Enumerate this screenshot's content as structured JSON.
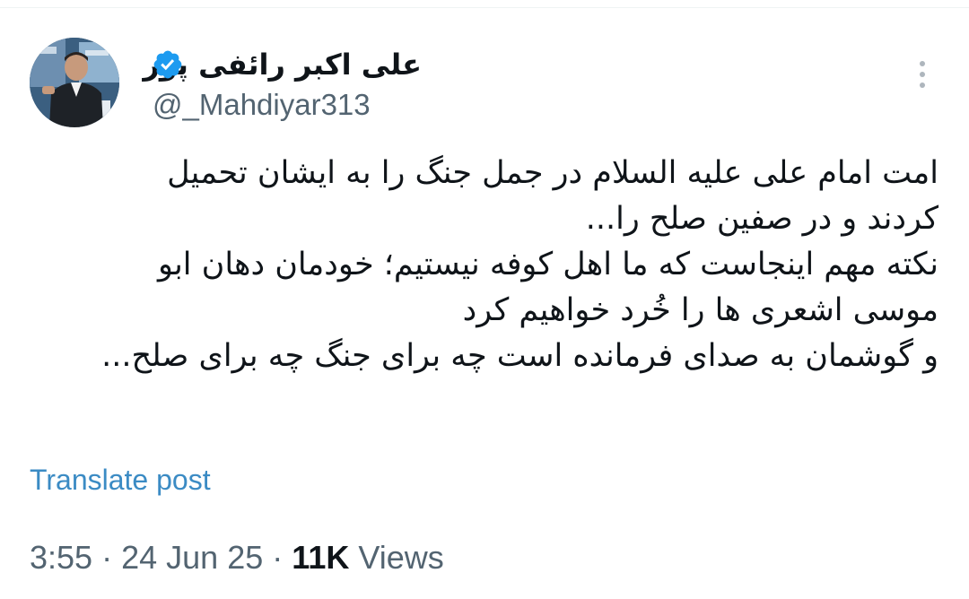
{
  "author": {
    "display_name": "علی اکبر رائفی پور",
    "handle": "@_Mahdiyar313",
    "verified": true,
    "avatar_icon": "profile-photo"
  },
  "post": {
    "lines": [
      "امت امام علی علیه السلام در جمل جنگ را به ایشان تحمیل",
      "کردند و در صفین صلح را...",
      "نکته مهم اینجاست که ما اهل کوفه نیستیم؛ خودمان دهان ابو",
      "موسی اشعری ها را خُرد خواهیم کرد",
      "و گوشمان به صدای فرمانده است چه برای جنگ چه برای صلح..."
    ],
    "translate_label": "Translate post"
  },
  "meta": {
    "time": "3:55",
    "separator": "·",
    "date": "24 Jun 25",
    "views_count": "11K",
    "views_label": "Views"
  },
  "colors": {
    "verified": "#1d9bf0",
    "link": "#3b8bc4",
    "secondary_text": "#536471",
    "primary_text": "#0f1419"
  }
}
